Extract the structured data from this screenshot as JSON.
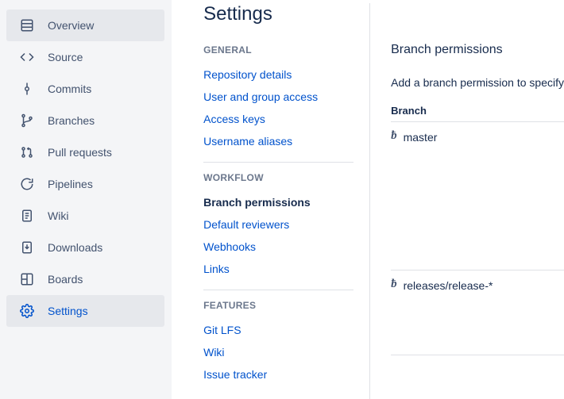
{
  "sidebar": {
    "items": [
      {
        "label": "Overview",
        "icon": "overview-icon",
        "active": true
      },
      {
        "label": "Source",
        "icon": "source-icon"
      },
      {
        "label": "Commits",
        "icon": "commits-icon"
      },
      {
        "label": "Branches",
        "icon": "branches-icon"
      },
      {
        "label": "Pull requests",
        "icon": "pullrequests-icon"
      },
      {
        "label": "Pipelines",
        "icon": "pipelines-icon"
      },
      {
        "label": "Wiki",
        "icon": "wiki-icon"
      },
      {
        "label": "Downloads",
        "icon": "downloads-icon"
      },
      {
        "label": "Boards",
        "icon": "boards-icon"
      },
      {
        "label": "Settings",
        "icon": "settings-icon",
        "settings": true,
        "active": true
      }
    ]
  },
  "page": {
    "title": "Settings"
  },
  "settings_nav": {
    "general": {
      "header": "GENERAL",
      "items": [
        "Repository details",
        "User and group access",
        "Access keys",
        "Username aliases"
      ]
    },
    "workflow": {
      "header": "WORKFLOW",
      "items": [
        "Branch permissions",
        "Default reviewers",
        "Webhooks",
        "Links"
      ],
      "current": "Branch permissions"
    },
    "features": {
      "header": "FEATURES",
      "items": [
        "Git LFS",
        "Wiki",
        "Issue tracker"
      ]
    }
  },
  "detail": {
    "title": "Branch permissions",
    "hint": "Add a branch permission to specify",
    "column_header": "Branch",
    "branches": [
      {
        "name": "master"
      },
      {
        "name": "releases/release-*"
      }
    ]
  }
}
